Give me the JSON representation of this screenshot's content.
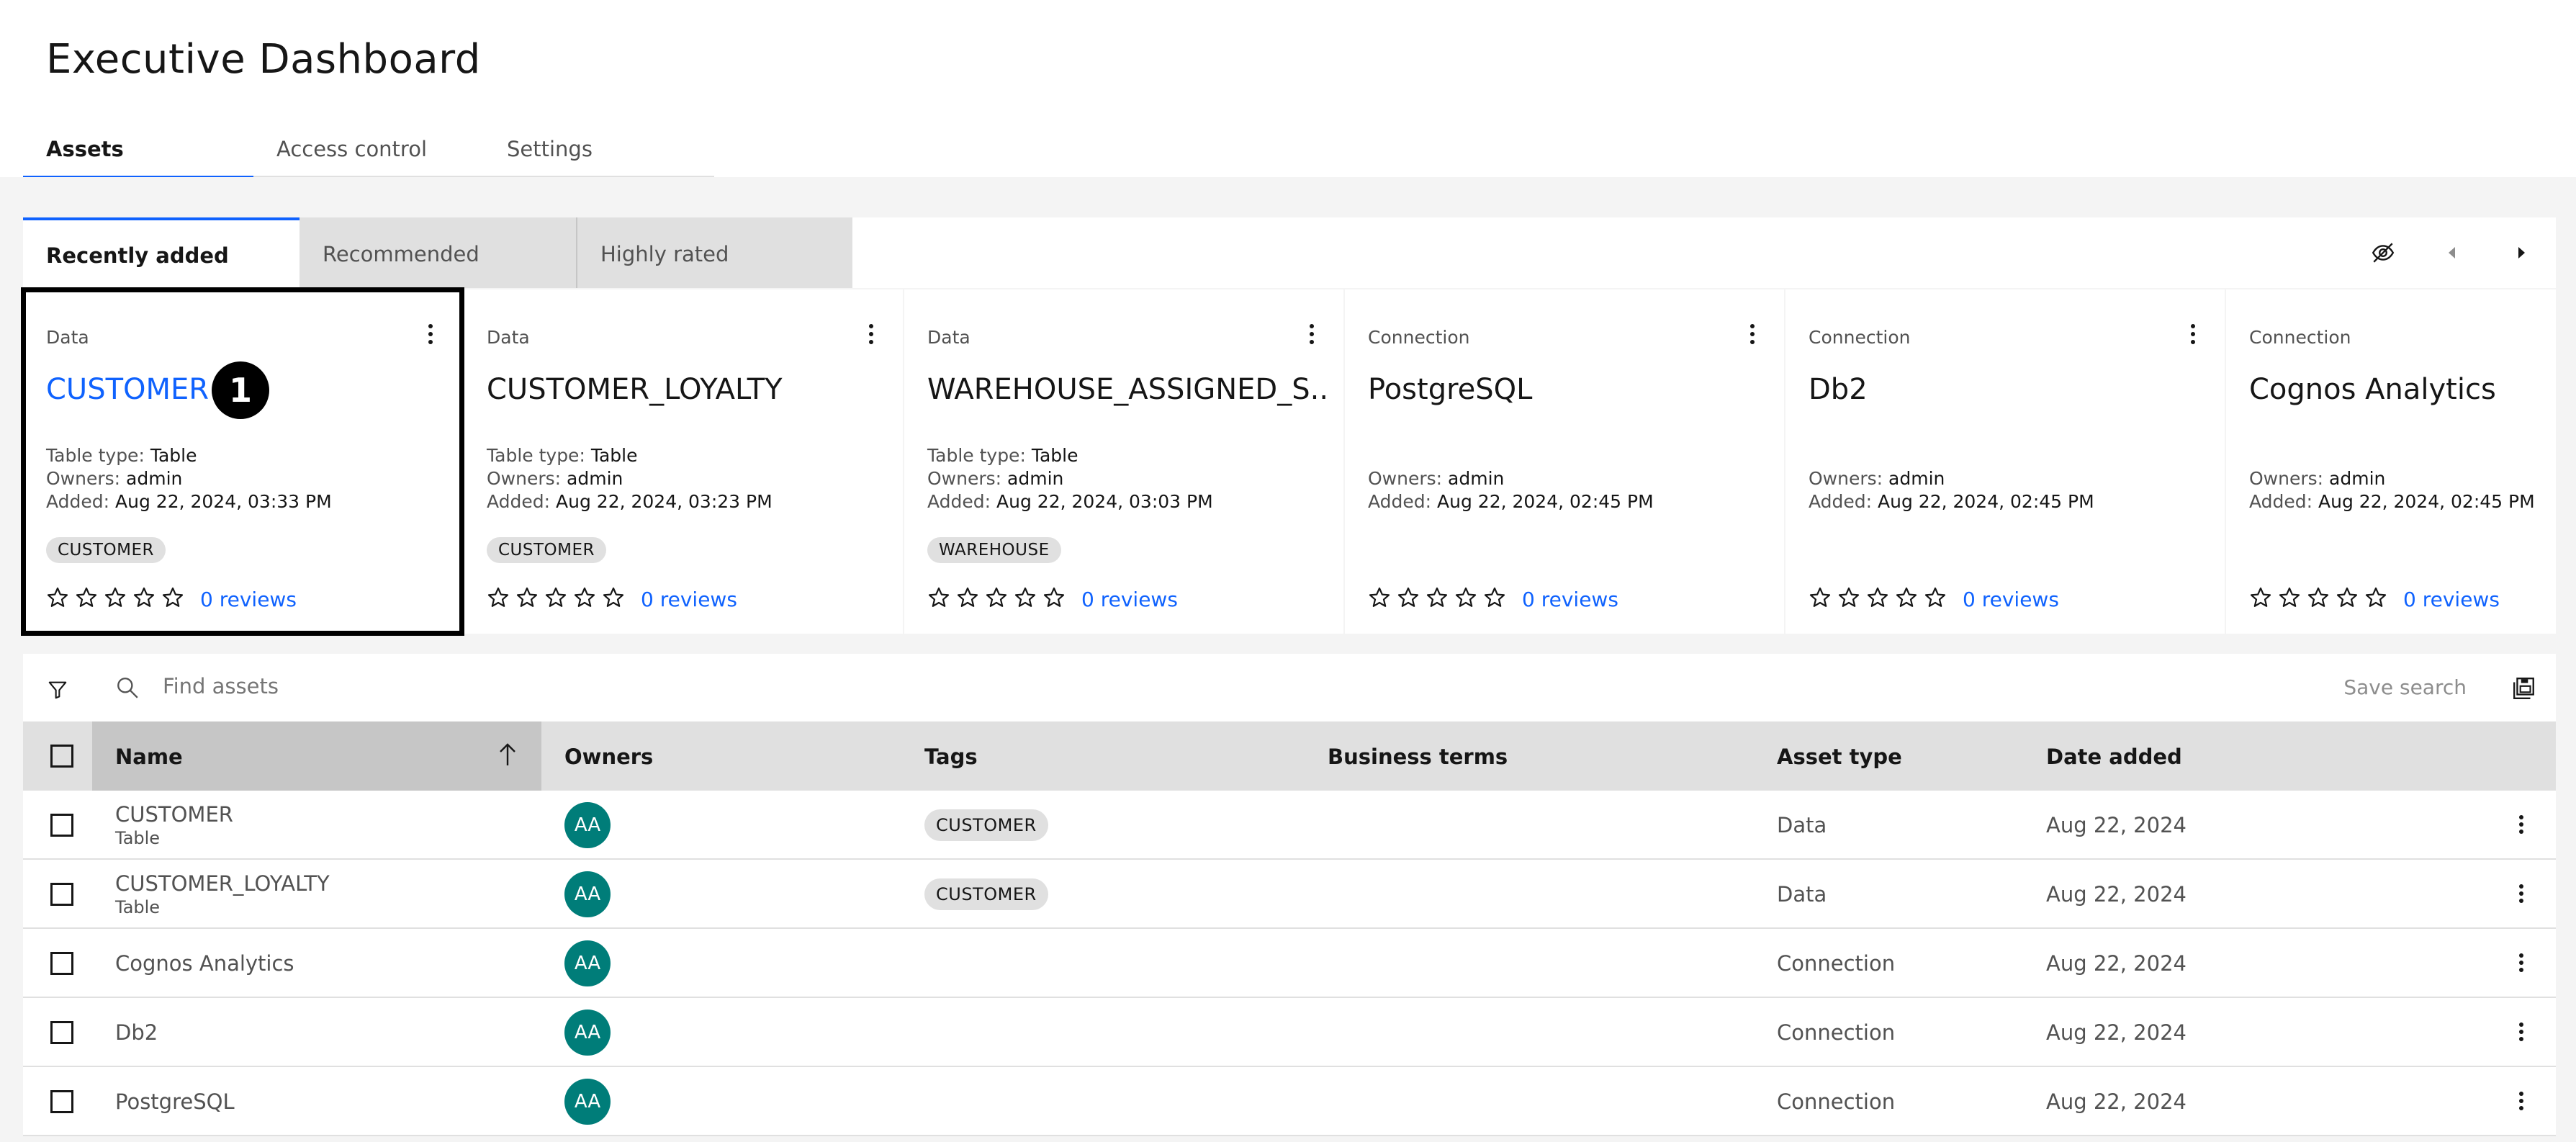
{
  "page": {
    "title": "Executive Dashboard"
  },
  "tabs": [
    {
      "label": "Assets",
      "active": true
    },
    {
      "label": "Access control",
      "active": false
    },
    {
      "label": "Settings",
      "active": false
    }
  ],
  "subtabs": [
    {
      "label": "Recently added",
      "active": true
    },
    {
      "label": "Recommended",
      "active": false
    },
    {
      "label": "Highly rated",
      "active": false
    }
  ],
  "carousel": {
    "hide_icon": "eye-slash-icon",
    "prev_icon": "caret-left-icon",
    "next_icon": "caret-right-icon"
  },
  "cards": [
    {
      "type": "Data",
      "title": "CUSTOMER",
      "table_type_label": "Table type:",
      "table_type": "Table",
      "owners_label": "Owners:",
      "owners": "admin",
      "added_label": "Added:",
      "added": "Aug 22, 2024, 03:33 PM",
      "tag": "CUSTOMER",
      "rating": 0,
      "reviews": "0 reviews",
      "badge": "1"
    },
    {
      "type": "Data",
      "title": "CUSTOMER_LOYALTY",
      "table_type_label": "Table type:",
      "table_type": "Table",
      "owners_label": "Owners:",
      "owners": "admin",
      "added_label": "Added:",
      "added": "Aug 22, 2024, 03:23 PM",
      "tag": "CUSTOMER",
      "rating": 0,
      "reviews": "0 reviews"
    },
    {
      "type": "Data",
      "title": "WAREHOUSE_ASSIGNED_S...",
      "table_type_label": "Table type:",
      "table_type": "Table",
      "owners_label": "Owners:",
      "owners": "admin",
      "added_label": "Added:",
      "added": "Aug 22, 2024, 03:03 PM",
      "tag": "WAREHOUSE",
      "rating": 0,
      "reviews": "0 reviews"
    },
    {
      "type": "Connection",
      "title": "PostgreSQL",
      "owners_label": "Owners:",
      "owners": "admin",
      "added_label": "Added:",
      "added": "Aug 22, 2024, 02:45 PM",
      "rating": 0,
      "reviews": "0 reviews"
    },
    {
      "type": "Connection",
      "title": "Db2",
      "owners_label": "Owners:",
      "owners": "admin",
      "added_label": "Added:",
      "added": "Aug 22, 2024, 02:45 PM",
      "rating": 0,
      "reviews": "0 reviews"
    },
    {
      "type": "Connection",
      "title": "Cognos Analytics",
      "owners_label": "Owners:",
      "owners": "admin",
      "added_label": "Added:",
      "added": "Aug 22, 2024, 02:45 PM",
      "rating": 0,
      "reviews": "0 reviews"
    }
  ],
  "search": {
    "placeholder": "Find assets",
    "save_label": "Save search",
    "filter_icon": "filter-icon",
    "search_icon": "search-icon",
    "save_icon": "save-search-icon"
  },
  "table": {
    "headers": {
      "name": "Name",
      "owners": "Owners",
      "tags": "Tags",
      "business_terms": "Business terms",
      "asset_type": "Asset type",
      "date_added": "Date added"
    },
    "sort": "ascending",
    "rows": [
      {
        "name": "CUSTOMER",
        "sub": "Table",
        "owner": "AA",
        "tag": "CUSTOMER",
        "asset_type": "Data",
        "date": "Aug 22, 2024"
      },
      {
        "name": "CUSTOMER_LOYALTY",
        "sub": "Table",
        "owner": "AA",
        "tag": "CUSTOMER",
        "asset_type": "Data",
        "date": "Aug 22, 2024"
      },
      {
        "name": "Cognos Analytics",
        "owner": "AA",
        "asset_type": "Connection",
        "date": "Aug 22, 2024"
      },
      {
        "name": "Db2",
        "owner": "AA",
        "asset_type": "Connection",
        "date": "Aug 22, 2024"
      },
      {
        "name": "PostgreSQL",
        "owner": "AA",
        "asset_type": "Connection",
        "date": "Aug 22, 2024"
      }
    ]
  },
  "colors": {
    "accent": "#0f62fe",
    "avatar": "#007d79",
    "panel": "#f4f4f4"
  }
}
